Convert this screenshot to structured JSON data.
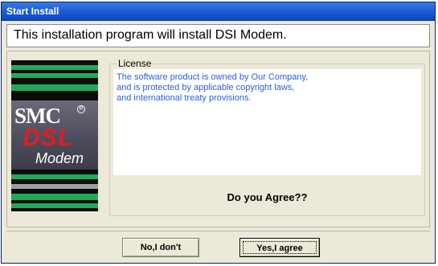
{
  "window": {
    "title": "Start Install"
  },
  "banner": {
    "text": "This installation program will install DSI Modem."
  },
  "sidebar_logo": {
    "line1": "SMC",
    "line2": "DSL",
    "line3": "Modem",
    "accent_color": "#21a85a",
    "dsl_color": "#e01e24"
  },
  "license": {
    "label": "License",
    "lines": [
      "The software product is owned by Our Company,",
      "and is protected by applicable copyright laws,",
      "and international treaty provisions."
    ],
    "text_color": "#2b5fd9"
  },
  "prompt": {
    "question": "Do you Agree??"
  },
  "buttons": {
    "no_label": "No,I don't",
    "yes_label": "Yes,I agree"
  }
}
